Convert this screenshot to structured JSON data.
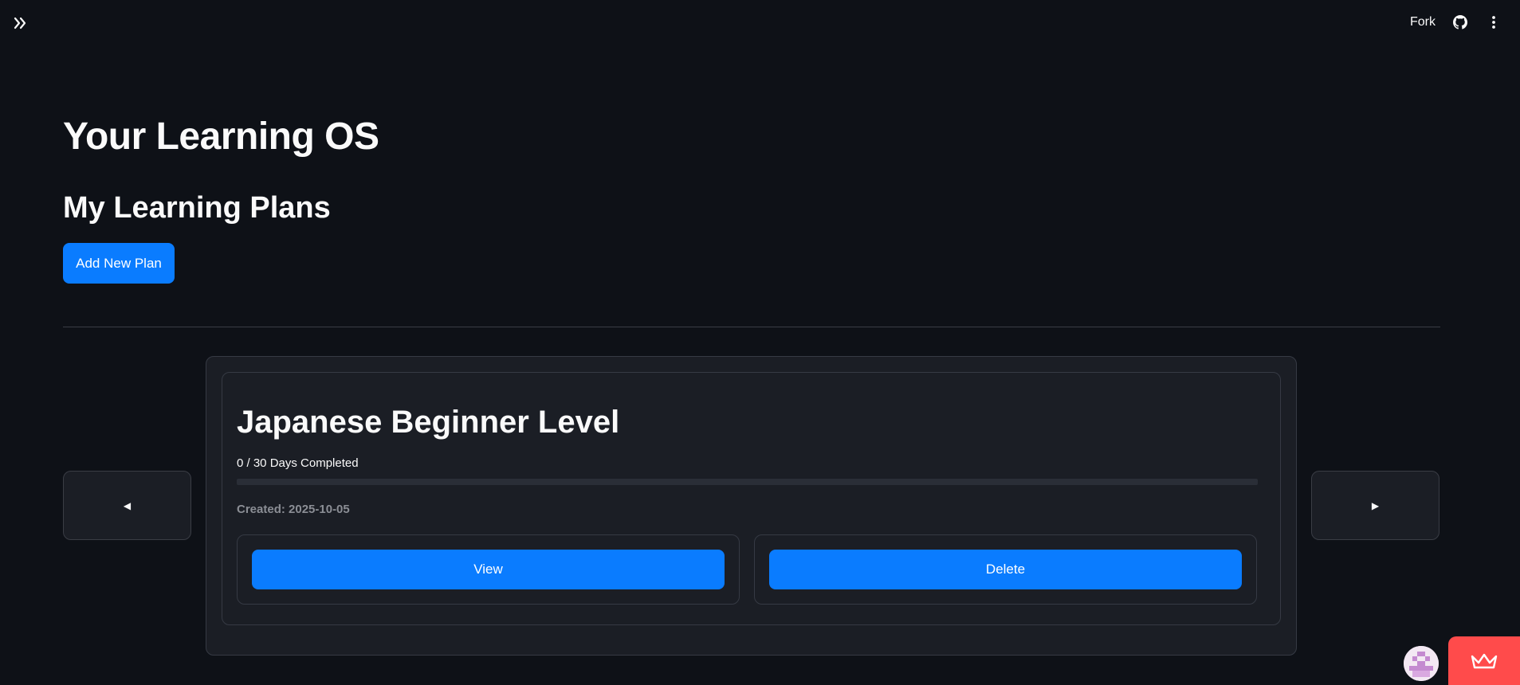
{
  "header": {
    "fork_label": "Fork",
    "sidebar_toggle_icon": "double-chevron-right-icon",
    "github_icon": "github-icon",
    "menu_icon": "vertical-dots-icon"
  },
  "main": {
    "app_title": "Your Learning OS",
    "section_title": "My Learning Plans",
    "add_plan_label": "Add New Plan"
  },
  "carousel": {
    "prev_label": "◀",
    "next_label": "▶",
    "plan": {
      "title": "Japanese Beginner Level",
      "progress_text": "0 / 30 Days Completed",
      "progress_fraction": 0,
      "created_text": "Created: 2025-10-05",
      "view_label": "View",
      "delete_label": "Delete"
    }
  },
  "colors": {
    "background": "#0e1117",
    "primary": "#0a7cff",
    "card": "#1b1e25",
    "badge": "#ff4b4b"
  }
}
